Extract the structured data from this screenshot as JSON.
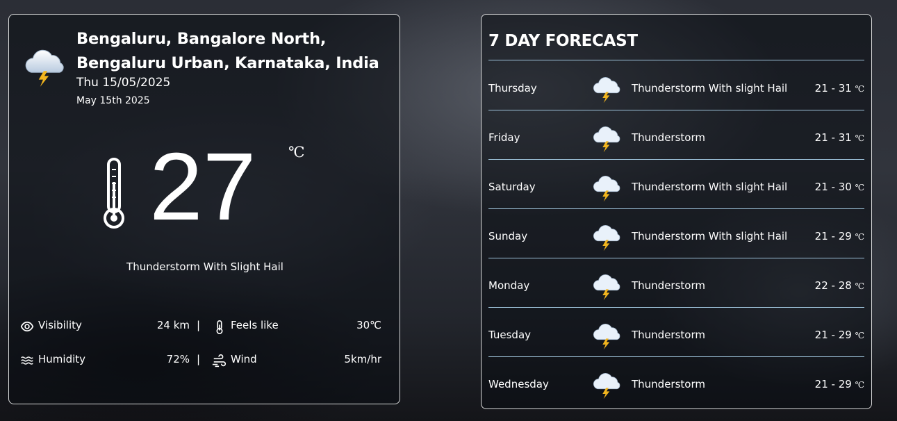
{
  "current": {
    "location": "Bengaluru, Bangalore North, Bengaluru Urban, Karnataka, India",
    "date_short": "Thu 15/05/2025",
    "date_long": "May 15th 2025",
    "temperature": "27",
    "unit": "℃",
    "condition": "Thunderstorm With Slight Hail",
    "icon": "thunderstorm-cloud-icon",
    "visibility_label": "Visibility",
    "visibility_value": "24 km",
    "feels_like_label": "Feels like",
    "feels_like_value": "30℃",
    "humidity_label": "Humidity",
    "humidity_value": "72%",
    "wind_label": "Wind",
    "wind_value": "5km/hr",
    "separator": "|"
  },
  "forecast": {
    "title": "7 DAY FORECAST",
    "unit": "℃",
    "days": [
      {
        "day": "Thursday",
        "condition": "Thunderstorm With slight Hail",
        "range": "21 - 31"
      },
      {
        "day": "Friday",
        "condition": "Thunderstorm",
        "range": "21 - 31"
      },
      {
        "day": "Saturday",
        "condition": "Thunderstorm With slight Hail",
        "range": "21 - 30"
      },
      {
        "day": "Sunday",
        "condition": "Thunderstorm With slight Hail",
        "range": "21 - 29"
      },
      {
        "day": "Monday",
        "condition": "Thunderstorm",
        "range": "22 - 28"
      },
      {
        "day": "Tuesday",
        "condition": "Thunderstorm",
        "range": "21 - 29"
      },
      {
        "day": "Wednesday",
        "condition": "Thunderstorm",
        "range": "21 - 29"
      }
    ]
  },
  "colors": {
    "divider": "#9fc4dc",
    "card_border": "#ffffff",
    "bolt": "#f2b51e"
  }
}
